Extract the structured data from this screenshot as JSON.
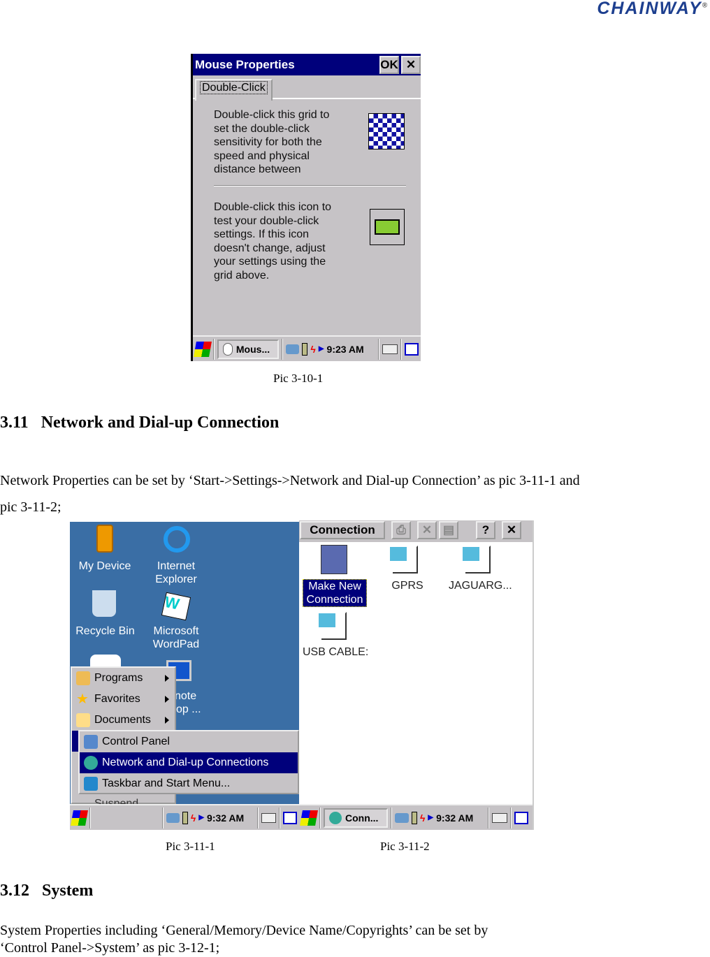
{
  "logo": {
    "text": "CHAINWAY",
    "mark": "®"
  },
  "pic1": {
    "title": "Mouse Properties",
    "ok": "OK",
    "close": "✕",
    "tab": "Double-Click",
    "text1": "Double-click this grid to set the double-click sensitivity for both the speed and physical distance between",
    "text2": "Double-click this icon to test your double-click settings. If this icon doesn't change, adjust your settings using the grid above.",
    "task": "Mous...",
    "time": "9:23 AM",
    "caption": "Pic 3-10-1"
  },
  "section311": {
    "num": "3.11",
    "title": "Network and Dial-up Connection",
    "para": "Network Properties can be set by ‘Start->Settings->Network and Dial-up Connection’ as pic 3-11-1 and pic 3-11-2;"
  },
  "pic2": {
    "icons": [
      "My Device",
      "Internet Explorer",
      "Recycle Bin",
      "Microsoft WordPad",
      "note",
      "op ..."
    ],
    "menu": [
      "Programs",
      "Favorites",
      "Documents",
      "Suspend"
    ],
    "submenu": [
      "Control Panel",
      "Network and Dial-up Connections",
      "Taskbar and Start Menu..."
    ],
    "time": "9:32 AM",
    "caption": "Pic 3-11-1"
  },
  "pic3": {
    "title": "Connection",
    "help": "?",
    "close": "✕",
    "items": [
      "Make New Connection",
      "GPRS",
      "JAGUARG...",
      "USB CABLE:"
    ],
    "task": "Conn...",
    "time": "9:32 AM",
    "caption": "Pic 3-11-2"
  },
  "section312": {
    "num": "3.12",
    "title": "System",
    "para1": "System Properties including ‘General/Memory/Device Name/Copyrights’ can be set by",
    "para2": "‘Control Panel->System’ as pic 3-12-1;"
  },
  "colors": {
    "titlebar": "#00007b",
    "desktop": "#3a6ea5",
    "logo": "#1d3f8f"
  }
}
